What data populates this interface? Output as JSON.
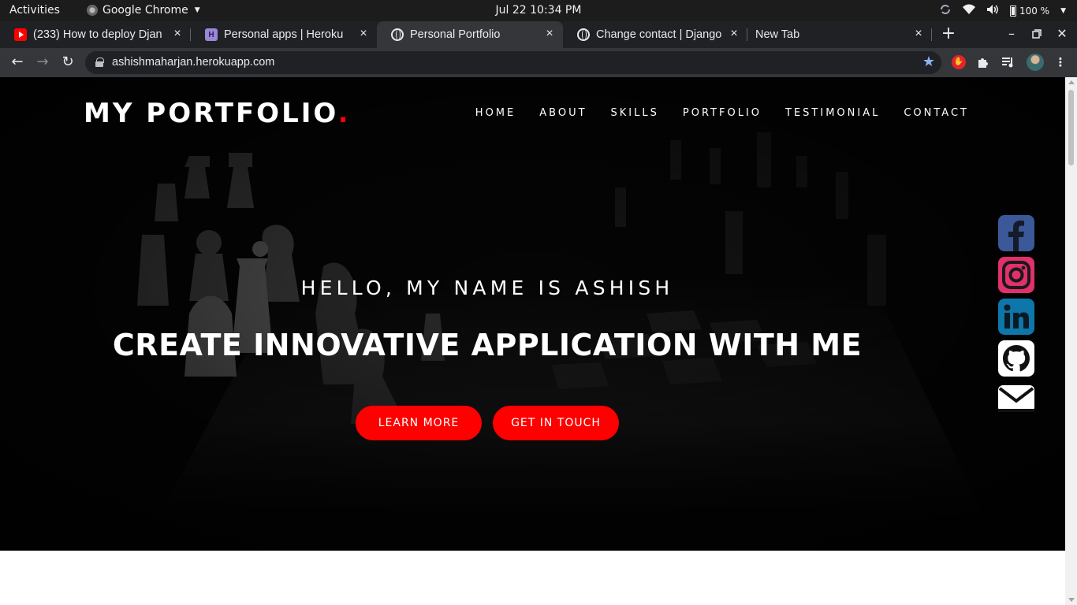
{
  "system_bar": {
    "activities": "Activities",
    "app_name": "Google Chrome",
    "clock": "Jul 22  10:34 PM",
    "battery": "100 %"
  },
  "tabs": [
    {
      "title": "(233) How to deploy Djan",
      "favicon": "youtube-icon"
    },
    {
      "title": "Personal apps | Heroku",
      "favicon": "heroku-icon"
    },
    {
      "title": "Personal Portfolio",
      "favicon": "globe-icon",
      "active": true
    },
    {
      "title": "Change contact | Django",
      "favicon": "globe-icon"
    },
    {
      "title": "New Tab",
      "favicon": ""
    }
  ],
  "omnibox": {
    "url": "ashishmaharjan.herokuapp.com"
  },
  "site": {
    "brand": "MY PORTFOLIO",
    "brand_dot": ".",
    "nav": [
      "HOME",
      "ABOUT",
      "SKILLS",
      "PORTFOLIO",
      "TESTIMONIAL",
      "CONTACT"
    ],
    "greeting": "HELLO, MY NAME IS ASHISH",
    "headline": "CREATE INNOVATIVE APPLICATION WITH ME",
    "buttons": {
      "learn_more": "LEARN MORE",
      "get_in_touch": "GET IN TOUCH"
    },
    "social": [
      "facebook-icon",
      "instagram-icon",
      "linkedin-icon",
      "github-icon",
      "mail-icon"
    ]
  },
  "colors": {
    "accent": "#ff0000",
    "facebook": "#3b5998",
    "instagram": "#e1306c",
    "linkedin": "#0e76a8",
    "hero_bg": "#030303"
  }
}
